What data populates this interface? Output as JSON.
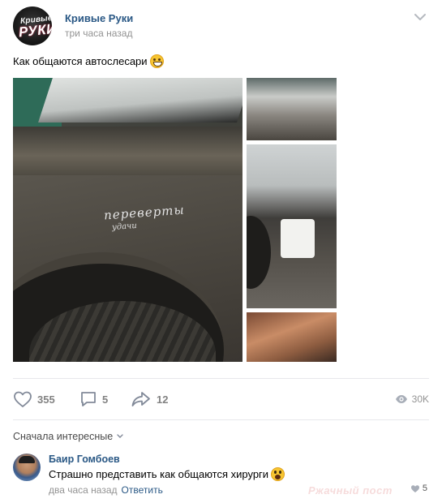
{
  "post": {
    "author": "Кривые Руки",
    "avatar_lines": [
      "Кривые",
      "РУКИ"
    ],
    "time": "три часа назад",
    "text": "Как общаются автослесари",
    "photo_chalk_lines": [
      "переверты",
      "удачи"
    ]
  },
  "actions": {
    "likes": "355",
    "comments": "5",
    "shares": "12",
    "views": "30K"
  },
  "comments_section": {
    "sort_label": "Сначала интересные",
    "items": [
      {
        "author": "Баир Гомбоев",
        "text": "Страшно представить как общаются хирурги",
        "time": "два часа назад",
        "reply_label": "Ответить",
        "likes": "5"
      }
    ]
  },
  "watermark": "Ржачный пост",
  "colors": {
    "link": "#2a5885",
    "meta": "#939393",
    "icon": "#828a99",
    "divider": "#e7e8ec"
  }
}
